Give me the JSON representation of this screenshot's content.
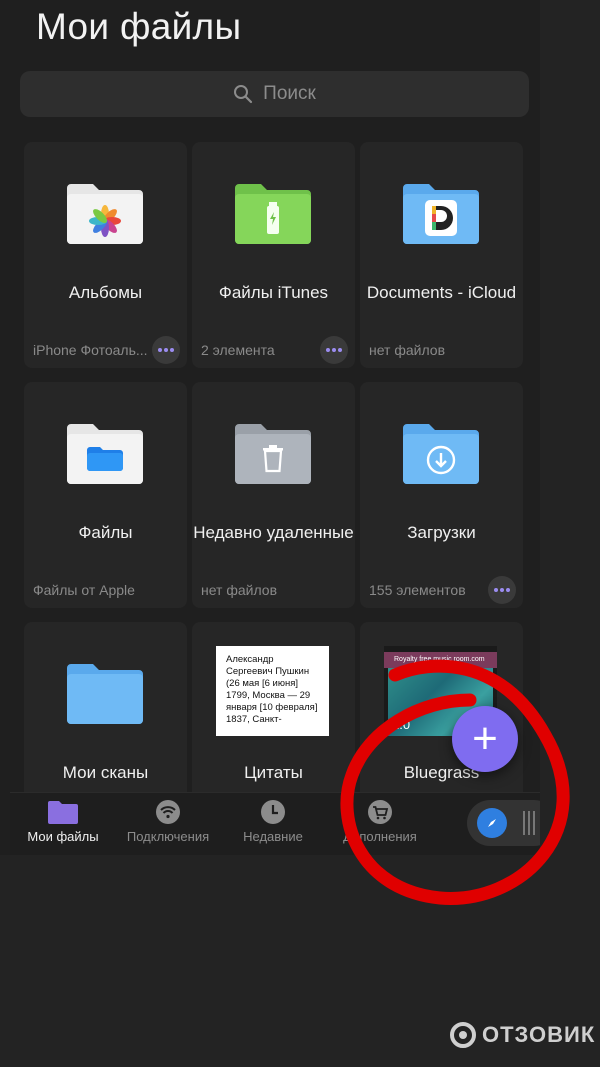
{
  "header": {
    "title": "Мои файлы"
  },
  "search": {
    "placeholder": "Поиск"
  },
  "folders": [
    {
      "name": "Альбомы",
      "sub": "iPhone Фотоаль...",
      "icon": "photos-folder-icon",
      "has_more": true
    },
    {
      "name": "Файлы iTunes",
      "sub": "2 элемента",
      "icon": "usb-folder-icon",
      "has_more": true
    },
    {
      "name": "Documents - iCloud",
      "sub": "нет файлов",
      "icon": "documents-folder-icon",
      "has_more": false
    },
    {
      "name": "Файлы",
      "sub": "Файлы от Apple",
      "icon": "files-folder-icon",
      "has_more": false
    },
    {
      "name": "Недавно удаленные",
      "sub": "нет файлов",
      "icon": "trash-folder-icon",
      "has_more": false
    },
    {
      "name": "Загрузки",
      "sub": "155 элементов",
      "icon": "download-folder-icon",
      "has_more": true
    },
    {
      "name": "Мои сканы",
      "icon": "scans-folder-icon"
    },
    {
      "name": "Цитаты",
      "thumb_text": "Александр Сергеевич Пушкин (26 мая [6 июня] 1799, Москва — 29 января [10 февраля] 1837, Санкт-",
      "icon": "text-thumbnail"
    },
    {
      "name": "Bluegrass",
      "thumb_caption": "Royalty free music room.com",
      "thumb_time": "2:0",
      "icon": "video-thumbnail"
    }
  ],
  "tabs": [
    {
      "label": "Мои файлы",
      "icon": "folder-icon",
      "active": true
    },
    {
      "label": "Подключения",
      "icon": "wifi-icon",
      "active": false
    },
    {
      "label": "Недавние",
      "icon": "clock-icon",
      "active": false
    },
    {
      "label": "Дополнения",
      "icon": "cart-icon",
      "active": false
    }
  ],
  "fab": {
    "label": "+"
  },
  "watermark": {
    "text": "ОТЗОВИК"
  },
  "colors": {
    "accent": "#7f6cf0",
    "background": "#1f1f1f",
    "card": "#262626",
    "annotation": "#e00000"
  }
}
